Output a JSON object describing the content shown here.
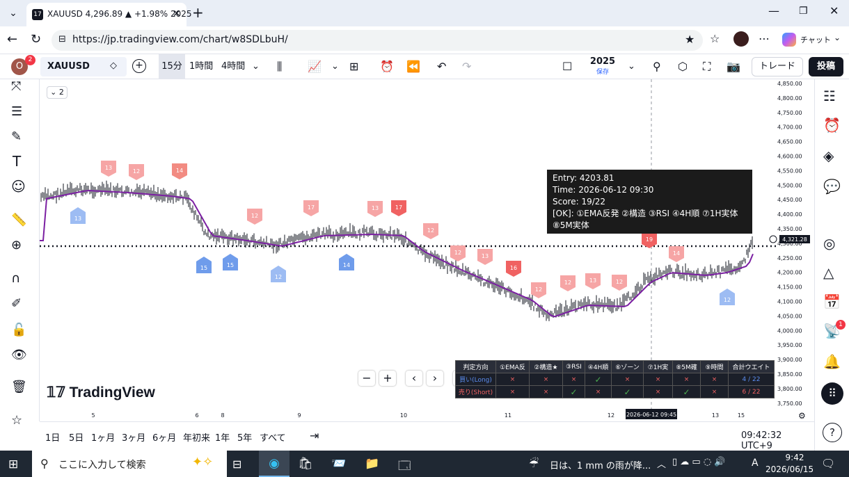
{
  "browser": {
    "tab_title": "XAUUSD 4,296.89 ▲ +1.98% 2025",
    "url": "https://jp.tradingview.com/chart/w8SDLbuH/",
    "chat_label": "チャット"
  },
  "toolbar": {
    "avatar_letter": "O",
    "avatar_badge": "2",
    "symbol": "XAUUSD",
    "intervals": [
      "15分",
      "1時間",
      "4時間"
    ],
    "year": "2025",
    "saved": "保存",
    "trade": "トレード",
    "publish": "投稿"
  },
  "chart": {
    "collapse_count": "2",
    "watermark": "TradingView",
    "price_labels": [
      "4,850.00",
      "4,800.00",
      "4,750.00",
      "4,700.00",
      "4,650.00",
      "4,600.00",
      "4,550.00",
      "4,500.00",
      "4,450.00",
      "4,400.00",
      "4,350.00",
      "4,300.00",
      "4,250.00",
      "4,200.00",
      "4,150.00",
      "4,100.00",
      "4,050.00",
      "4,000.00",
      "3,950.00",
      "3,900.00",
      "3,850.00",
      "3,800.00",
      "3,750.00"
    ],
    "current_price": "4,321.28",
    "time_labels": [
      "5",
      "6",
      "8",
      "9",
      "10",
      "11",
      "12",
      "13",
      "15"
    ],
    "crosshair_time": "2026-06-12 09:45",
    "markers_sell": [
      "13",
      "12",
      "14",
      "12",
      "17",
      "13",
      "17",
      "12",
      "12",
      "13",
      "16",
      "12",
      "12",
      "13",
      "12",
      "19",
      "14"
    ],
    "markers_buy": [
      "13",
      "15",
      "15",
      "12",
      "14",
      "12"
    ],
    "tooltip": {
      "l1": "Entry: 4203.81",
      "l2": "Time: 2026-06-12 09:30",
      "l3": "Score: 19/22",
      "l4": "[OK]: ①EMA反発 ②構造 ③RSI ④4H順 ⑦1H実体",
      "l5": "⑧5M実体"
    },
    "table": {
      "headers": [
        "判定方向",
        "①EMA反",
        "②構造★",
        "③RSI",
        "④4H順",
        "⑥ゾーン",
        "⑦1H実",
        "⑧5M確",
        "⑨時間",
        "合計ウエイト"
      ],
      "long": [
        "買い(Long)",
        "×",
        "×",
        "×",
        "✓",
        "×",
        "×",
        "×",
        "×",
        "4 / 22"
      ],
      "short": [
        "売り(Short)",
        "×",
        "×",
        "✓",
        "×",
        "✓",
        "×",
        "✓",
        "×",
        "6 / 22"
      ]
    }
  },
  "bottom": {
    "ranges": [
      "1日",
      "5日",
      "1ヶ月",
      "3ヶ月",
      "6ヶ月",
      "年初来",
      "1年",
      "5年",
      "すべて"
    ],
    "clock": "09:42:32 UTC+9"
  },
  "taskbar": {
    "search_placeholder": "ここに入力して検索",
    "weather": "日は、1 mm の雨が降...",
    "ime": "A",
    "time": "9:42",
    "date": "2026/06/15"
  },
  "notification_badge": "1",
  "colors": {
    "sell": "#f28b82",
    "buy": "#8ab4f8",
    "ema": "#7b1fa2",
    "accent": "#2962ff"
  }
}
